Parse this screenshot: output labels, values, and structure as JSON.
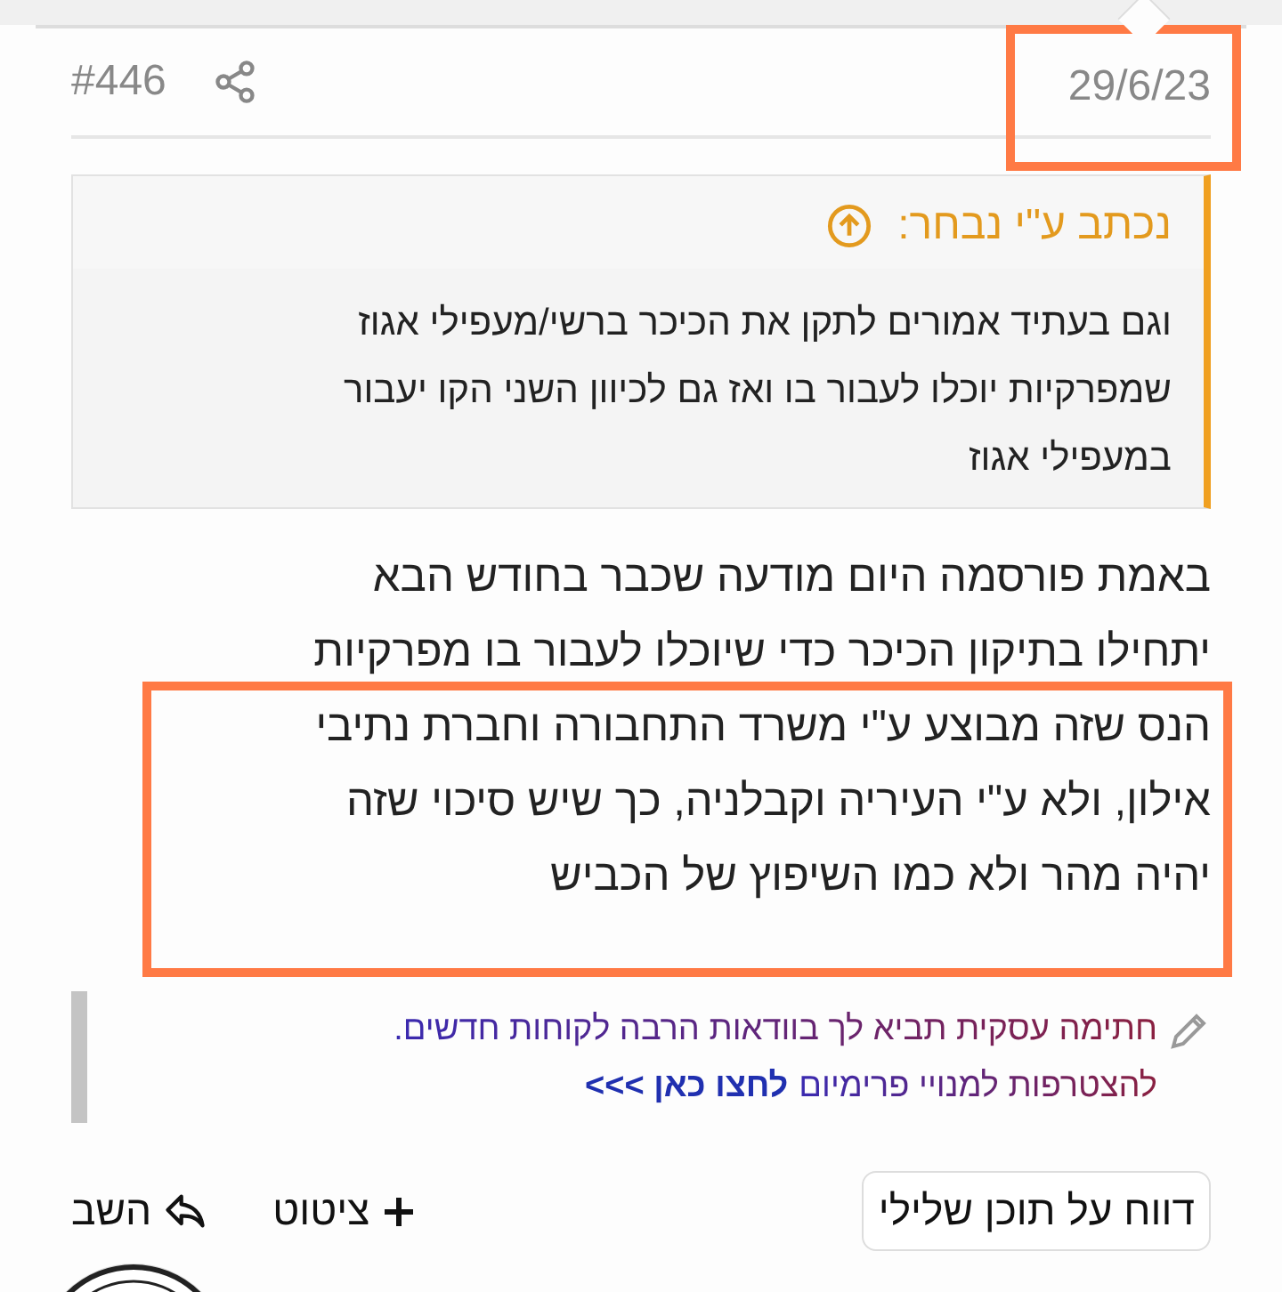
{
  "post": {
    "date": "29/6/23",
    "date_highlighted": true,
    "number": "#446"
  },
  "quote": {
    "title": "נכתב ע\"י נבחר:",
    "lines": [
      "וגם בעתיד אמורים לתקן את הכיכר ברשי/מעפילי אגוז",
      "שמפרקיות יוכלו לעבור בו ואז גם לכיוון השני הקו יעבור",
      "במעפילי אגוז"
    ]
  },
  "body": [
    {
      "highlighted": false,
      "lines": [
        "באמת פורסמה היום מודעה שכבר בחודש הבא",
        "יתחילו בתיקון הכיכר כדי שיוכלו לעבור בו מפרקיות"
      ]
    },
    {
      "highlighted": true,
      "lines": [
        "הנס שזה מבוצע ע\"י משרד התחבורה וחברת נתיבי",
        "אילון, ולא ע\"י העיריה וקבלניה, כך שיש סיכוי שזה",
        "יהיה מהר ולא כמו השיפוץ של הכביש"
      ]
    }
  ],
  "signature": {
    "text": "חתימה עסקית תביא לך בוודאות הרבה לקוחות חדשים.",
    "join_text": "להצטרפות למנויי פרימיום",
    "link": "לחצו כאן >>>"
  },
  "actions": {
    "report": "דווח על תוכן שלילי",
    "quote": "ציטוט",
    "reply": "השב"
  }
}
